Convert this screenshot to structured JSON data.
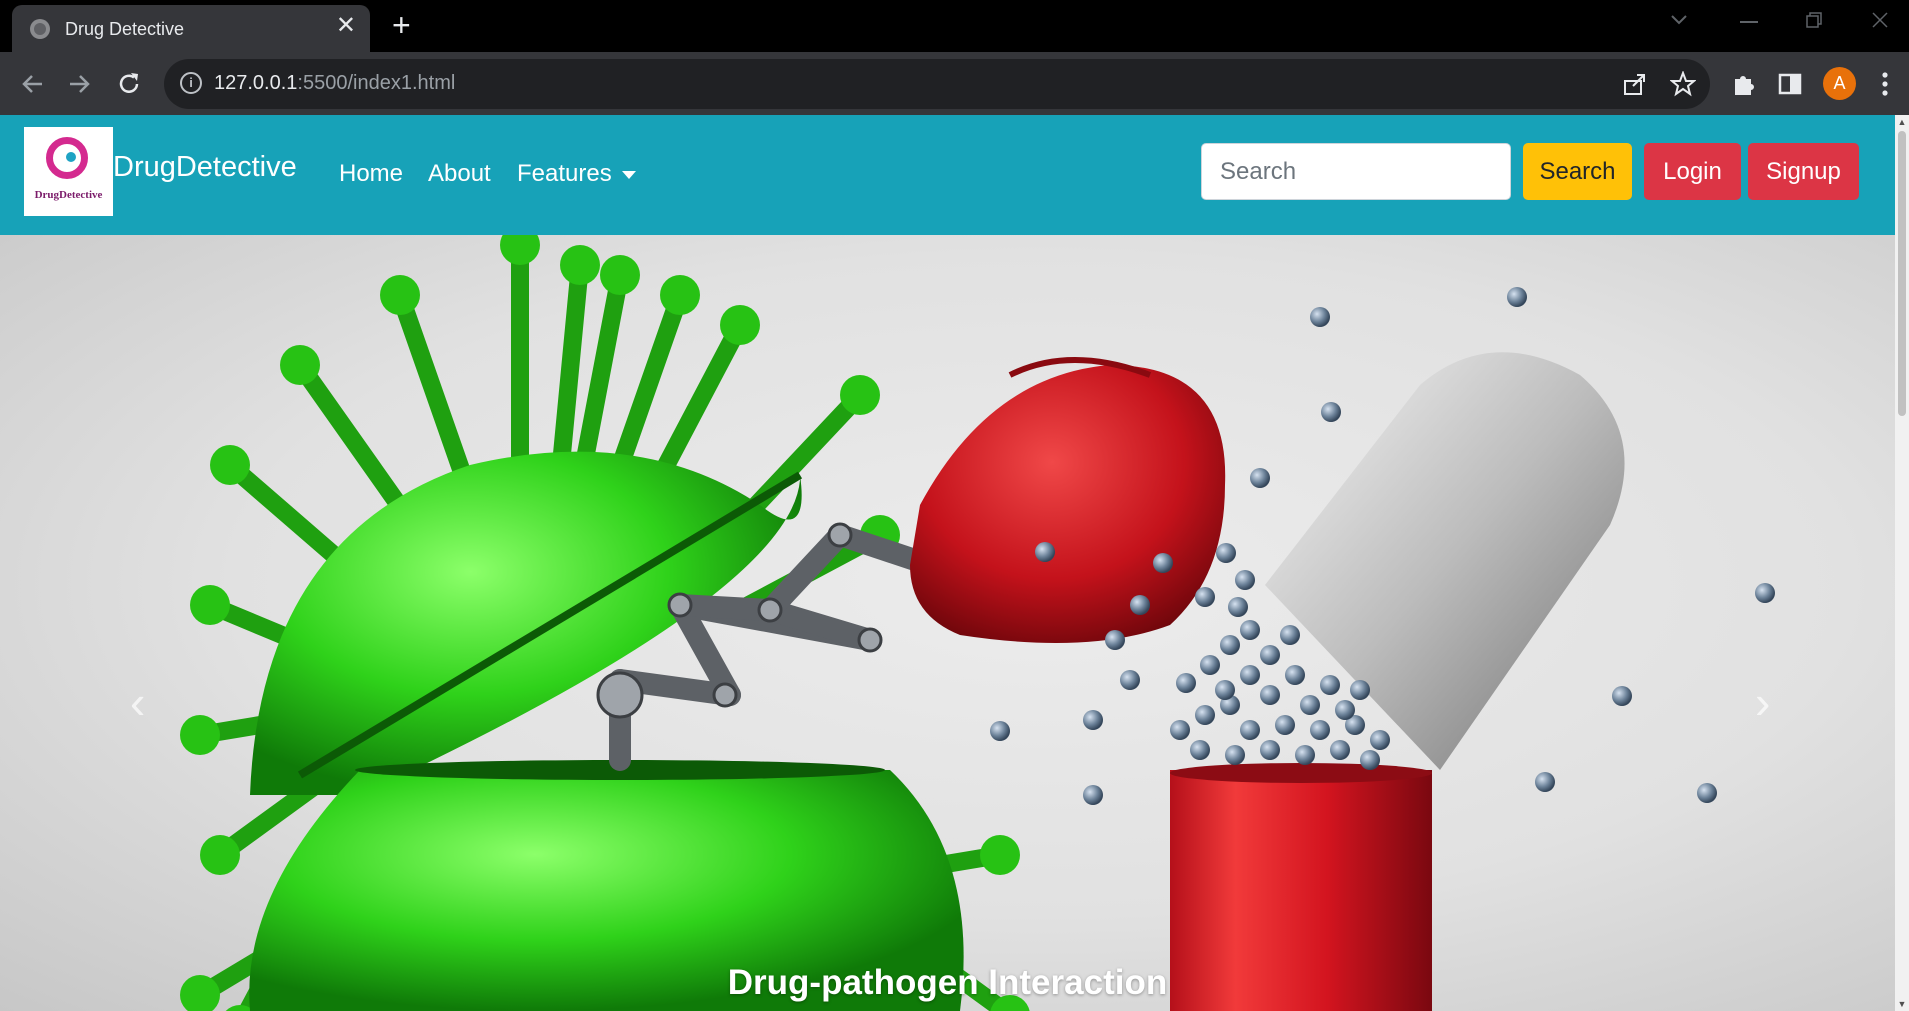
{
  "browser": {
    "tab_title": "Drug Detective",
    "tab_close": "✕",
    "new_tab": "+",
    "url_host": "127.0.0.1",
    "url_rest": ":5500/index1.html",
    "profile_initial": "A"
  },
  "navbar": {
    "brand": "DrugDetective",
    "logo_text": "DrugDetective",
    "links": [
      "Home",
      "About",
      "Features"
    ],
    "search_placeholder": "Search",
    "search_button": "Search",
    "login_button": "Login",
    "signup_button": "Signup",
    "color": "#17a2b8"
  },
  "carousel": {
    "caption": "Drug-pathogen Interaction",
    "prev_glyph": "‹",
    "next_glyph": "›",
    "image": "virus-vs-capsule-boxing-glove-icon"
  }
}
